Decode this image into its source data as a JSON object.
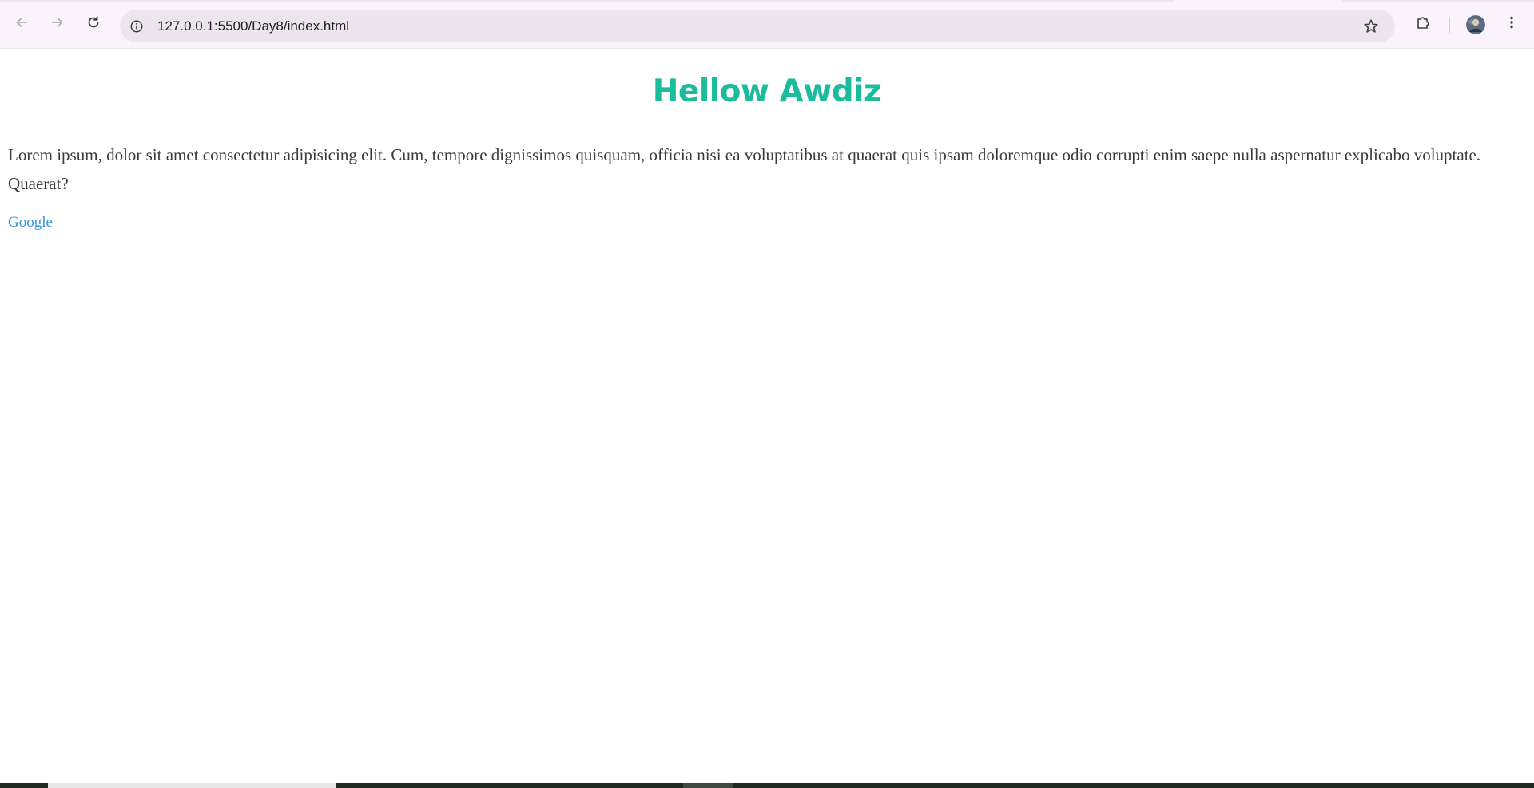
{
  "browser": {
    "url": "127.0.0.1:5500/Day8/index.html",
    "icons": {
      "back": "arrow-left-icon",
      "forward": "arrow-right-icon",
      "reload": "reload-icon",
      "site_info": "info-icon",
      "bookmark": "star-icon",
      "extensions": "puzzle-piece-icon",
      "profile": "avatar",
      "menu": "three-dots-icon"
    }
  },
  "page": {
    "heading": "Hellow Awdiz",
    "paragraph": "Lorem ipsum, dolor sit amet consectetur adipisicing elit. Cum, tempore dignissimos quisquam, officia nisi ea voluptatibus at quaerat quis ipsam doloremque odio corrupti enim saepe nulla aspernatur explicabo voluptate. Quaerat?",
    "link_text": "Google"
  },
  "colors": {
    "heading": "#1abc9c",
    "paragraph_text": "#3a3a3a",
    "link": "#3498db",
    "toolbar_bg": "#fbf3fc",
    "omnibox_bg": "#ede4f0"
  }
}
